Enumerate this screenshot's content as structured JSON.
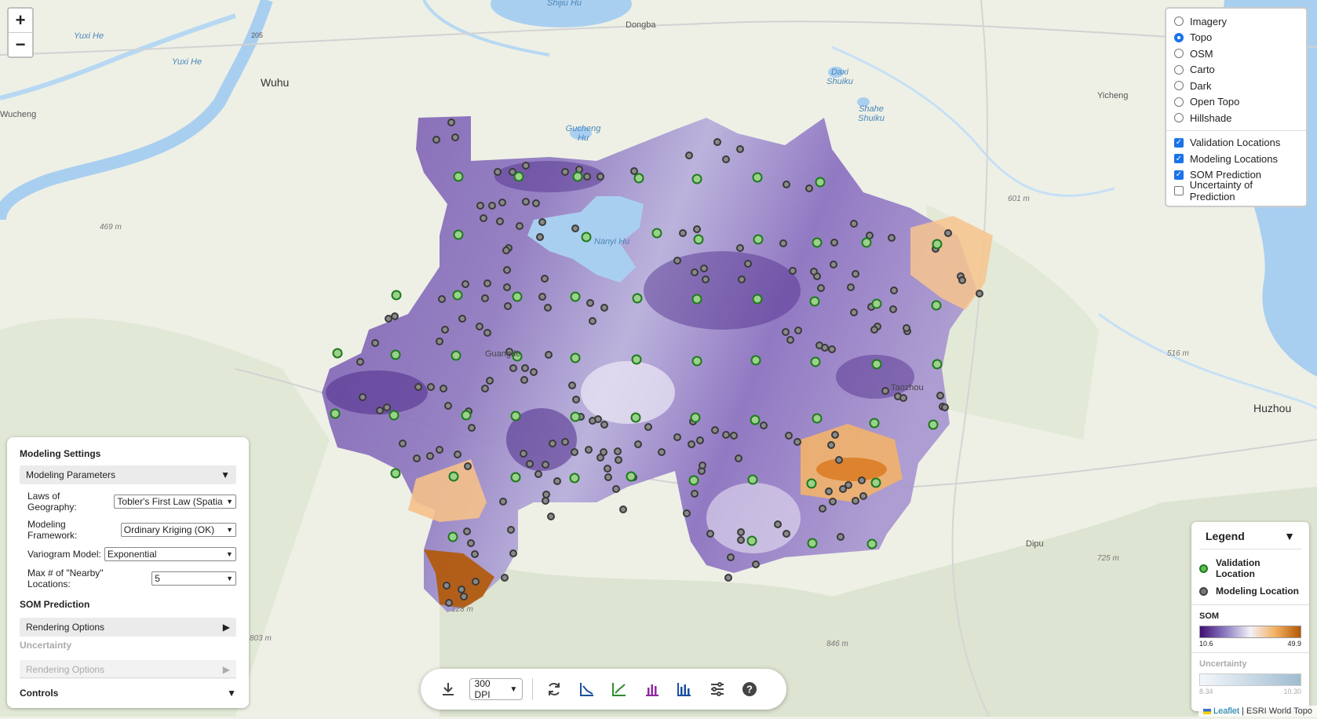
{
  "map": {
    "labels": [
      {
        "text": "Shijiu Hu",
        "kind": "water"
      },
      {
        "text": "Dongba",
        "kind": "town"
      },
      {
        "text": "Yuxi He",
        "kind": "water"
      },
      {
        "text": "Yuxi He",
        "kind": "water"
      },
      {
        "text": "Wuhu",
        "kind": "city"
      },
      {
        "text": "Wucheng",
        "kind": "town"
      },
      {
        "text": "Gucheng Hu",
        "kind": "water"
      },
      {
        "text": "Daxi Shuiku",
        "kind": "water"
      },
      {
        "text": "Shahe Shuiku",
        "kind": "water"
      },
      {
        "text": "Yicheng",
        "kind": "town"
      },
      {
        "text": "Nanyi Hu",
        "kind": "water"
      },
      {
        "text": "469 m",
        "kind": "elev"
      },
      {
        "text": "601 m",
        "kind": "elev"
      },
      {
        "text": "516 m",
        "kind": "elev"
      },
      {
        "text": "Huzhou",
        "kind": "city"
      },
      {
        "text": "Dipu",
        "kind": "town"
      },
      {
        "text": "725 m",
        "kind": "elev"
      },
      {
        "text": "846 m",
        "kind": "elev"
      },
      {
        "text": "803 m",
        "kind": "elev"
      },
      {
        "text": "128 m",
        "kind": "elev"
      },
      {
        "text": "Taozhou",
        "kind": "town"
      },
      {
        "text": "Guangde",
        "kind": "town"
      },
      {
        "text": "205",
        "kind": "town"
      }
    ]
  },
  "zoom": {
    "in": "+",
    "out": "−"
  },
  "layers": {
    "basemaps": [
      {
        "label": "Imagery",
        "selected": false
      },
      {
        "label": "Topo",
        "selected": true
      },
      {
        "label": "OSM",
        "selected": false
      },
      {
        "label": "Carto",
        "selected": false
      },
      {
        "label": "Dark",
        "selected": false
      },
      {
        "label": "Open Topo",
        "selected": false
      },
      {
        "label": "Hillshade",
        "selected": false
      }
    ],
    "overlays": [
      {
        "label": "Validation Locations",
        "checked": true
      },
      {
        "label": "Modeling Locations",
        "checked": true
      },
      {
        "label": "SOM Prediction",
        "checked": true
      },
      {
        "label": "Uncertainty of Prediction",
        "checked": false
      }
    ]
  },
  "settings": {
    "title": "Modeling Settings",
    "params_label": "Modeling Parameters",
    "params_arrow": "▼",
    "fields": [
      {
        "label": "Laws of Geography:",
        "value": "Tobler's First Law (Spatia"
      },
      {
        "label": "Modeling Framework:",
        "value": "Ordinary Kriging (OK)"
      },
      {
        "label": "Variogram Model:",
        "value": "Exponential"
      },
      {
        "label": "Max # of \"Nearby\" Locations:",
        "value": "5"
      }
    ],
    "som_heading": "SOM Prediction",
    "render_label": "Rendering Options",
    "render_arrow": "▶",
    "unc_heading": "Uncertainty",
    "render2_label": "Rendering Options",
    "render2_arrow": "▶",
    "controls_label": "Controls",
    "controls_arrow": "▼"
  },
  "legend": {
    "title": "Legend",
    "arrow": "▼",
    "validation": "Validation Location",
    "modeling": "Modeling Location",
    "som_title": "SOM",
    "som_min": "10.6",
    "som_max": "49.9",
    "unc_title": "Uncertainty",
    "unc_min": "8.34",
    "unc_max": "10.30",
    "colors": {
      "validation": "#2ca02c",
      "modeling": "#666666",
      "purple": "#3f0f72",
      "orange": "#b35806"
    }
  },
  "toolbar": {
    "dpi": "300 DPI",
    "icons": [
      "download-icon",
      "refresh-icon",
      "scatter-chart-icon",
      "trend-chart-icon",
      "bar-chart-purple-icon",
      "bar-chart-blue-icon",
      "sliders-icon",
      "help-icon"
    ]
  },
  "attribution": {
    "leaflet": "Leaflet",
    "sep": " | ",
    "source": "ESRI World Topo"
  }
}
